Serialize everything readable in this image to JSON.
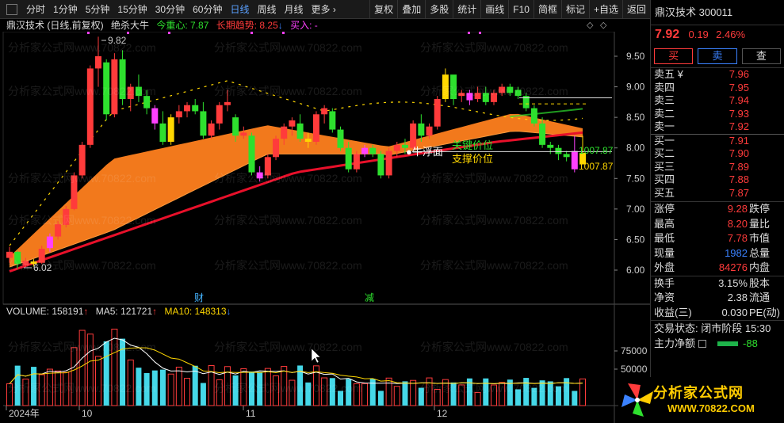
{
  "toolbar": {
    "periods": [
      "分时",
      "1分钟",
      "5分钟",
      "15分钟",
      "30分钟",
      "60分钟",
      "日线",
      "周线",
      "月线",
      "更多 ›"
    ],
    "active_period": "日线",
    "tools": [
      "复权",
      "叠加",
      "多股",
      "统计",
      "画线",
      "F10",
      "简框",
      "标记",
      "+自选",
      "返回"
    ]
  },
  "chart_header": {
    "stock": "鼎汉技术 (日线,前复权)",
    "indicator": "绝杀大牛",
    "center_label": "今重心: 7.87",
    "trend_label": "长期趋势: 8.25",
    "trend_arrow": "↓",
    "buy_label": "买入: -",
    "diamond": "◇",
    "close_mark": "◇"
  },
  "annotations": {
    "high_mark": "9.82",
    "low_mark": "6.02",
    "bull_face": "●牛浮面",
    "key_level": "关键价位",
    "support_level": "支撑价位",
    "key_value": "1007.87",
    "support_value": "1007.87",
    "event_cai": "财",
    "event_jian": "减"
  },
  "volume_header": {
    "volume": "VOLUME: 158191",
    "vol_arrow": "↑",
    "ma5": "MA5: 121721",
    "ma5_arrow": "↑",
    "ma10": "MA10: 148313",
    "ma10_arrow": "↓"
  },
  "axes": {
    "price_ticks": [
      "9.50",
      "9.00",
      "8.50",
      "8.00",
      "7.50",
      "7.00",
      "6.50",
      "6.00"
    ],
    "volume_ticks": [
      "75000",
      "50000"
    ],
    "time_labels": [
      "2024年",
      "10",
      "11",
      "12"
    ]
  },
  "panel": {
    "name": "鼎汉技术",
    "code": "300011",
    "price": "7.92",
    "change": "0.19",
    "pct": "2.46%",
    "buy_btn": "买",
    "sell_btn": "卖",
    "query_btn": "查",
    "asks": [
      {
        "label": "卖五 ¥",
        "price": "7.96"
      },
      {
        "label": "卖四",
        "price": "7.95"
      },
      {
        "label": "卖三",
        "price": "7.94"
      },
      {
        "label": "卖二",
        "price": "7.93"
      },
      {
        "label": "卖一",
        "price": "7.92"
      }
    ],
    "bids": [
      {
        "label": "买一",
        "price": "7.91"
      },
      {
        "label": "买二",
        "price": "7.90"
      },
      {
        "label": "买三",
        "price": "7.89"
      },
      {
        "label": "买四",
        "price": "7.88"
      },
      {
        "label": "买五",
        "price": "7.87"
      }
    ],
    "stats1": [
      {
        "k1": "涨停",
        "v1": "9.28",
        "c1": "red",
        "k2": "跌停"
      },
      {
        "k1": "最高",
        "v1": "8.20",
        "c1": "red",
        "k2": "量比"
      },
      {
        "k1": "最低",
        "v1": "7.78",
        "c1": "red",
        "k2": "市值"
      },
      {
        "k1": "现量",
        "v1": "1982",
        "c1": "blue",
        "k2": "总量"
      },
      {
        "k1": "外盘",
        "v1": "84276",
        "c1": "red",
        "k2": "内盘"
      }
    ],
    "stats2": [
      {
        "k1": "换手",
        "v1": "3.15%",
        "c1": "white",
        "k2": "股本"
      },
      {
        "k1": "净资",
        "v1": "2.38",
        "c1": "white",
        "k2": "流通"
      },
      {
        "k1": "收益(三)",
        "v1": "0.030",
        "c1": "white",
        "k2": "PE(动)"
      }
    ],
    "status": "交易状态: 闭市阶段 15:30",
    "flow_label": "主力净额",
    "flow_value": "-88"
  },
  "logo": {
    "main": "分析家公式网",
    "sub": "WWW.70822.COM"
  },
  "watermark_text": "分析家公式网www.70822.com",
  "colors": {
    "up": "#ff3b3b",
    "down": "#2ee02e",
    "band": "#ff7f1e",
    "ma_long": "#e8102a",
    "vol_up": "#ff3b3b",
    "vol_down": "#45d8e8"
  }
}
